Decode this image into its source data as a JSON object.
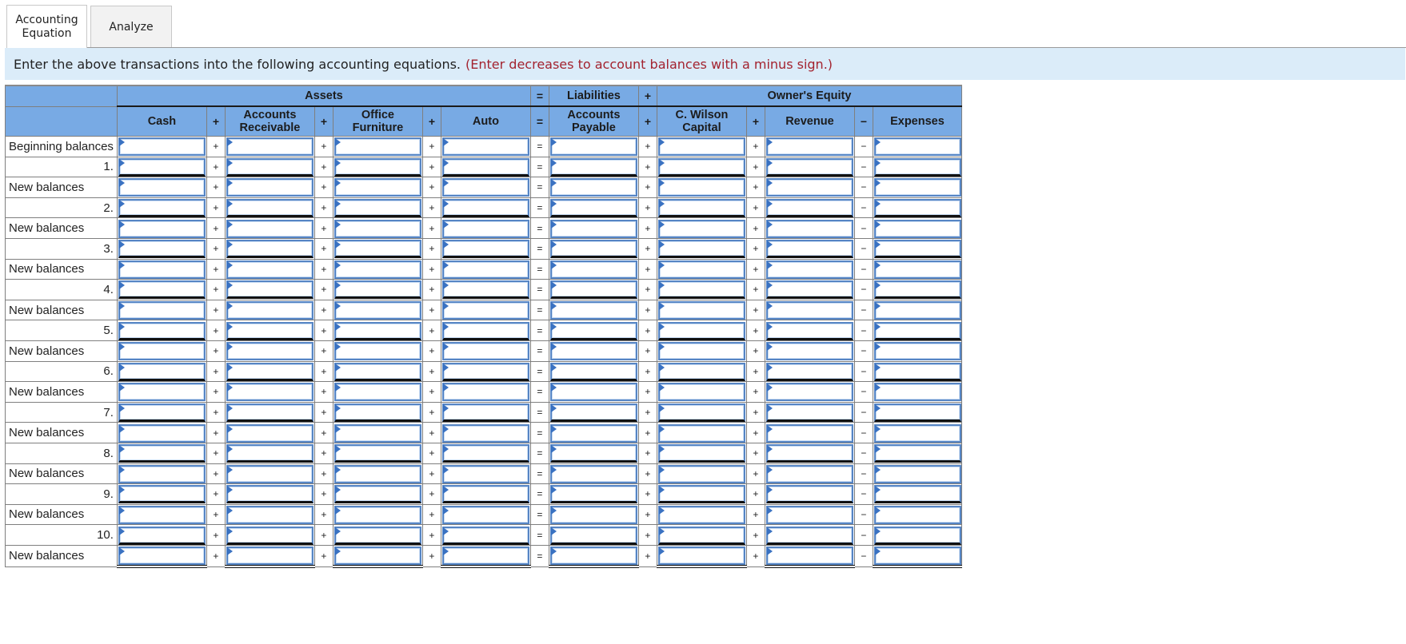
{
  "tabs": [
    {
      "label": "Accounting Equation",
      "active": true
    },
    {
      "label": "Analyze",
      "active": false
    }
  ],
  "instructions": {
    "text": "Enter the above transactions into the following accounting equations.",
    "note": "(Enter decreases to account balances with a minus sign.)"
  },
  "table": {
    "group_headers": {
      "assets": "Assets",
      "eq_sign": "=",
      "liabilities": "Liabilities",
      "plus_sign": "+",
      "owners_equity": "Owner's Equity"
    },
    "columns": [
      {
        "key": "cash",
        "label": "Cash"
      },
      {
        "key": "op1",
        "label": "+"
      },
      {
        "key": "accounts_receivable",
        "label": "Accounts Receivable"
      },
      {
        "key": "op2",
        "label": "+"
      },
      {
        "key": "office_furniture",
        "label": "Office Furniture"
      },
      {
        "key": "op3",
        "label": "+"
      },
      {
        "key": "auto",
        "label": "Auto"
      },
      {
        "key": "op4",
        "label": "="
      },
      {
        "key": "accounts_payable",
        "label": "Accounts Payable"
      },
      {
        "key": "op5",
        "label": "+"
      },
      {
        "key": "c_wilson_capital",
        "label": "C. Wilson Capital"
      },
      {
        "key": "op6",
        "label": "+"
      },
      {
        "key": "revenue",
        "label": "Revenue"
      },
      {
        "key": "op7",
        "label": "−"
      },
      {
        "key": "expenses",
        "label": "Expenses"
      }
    ],
    "row_operators": [
      "+",
      "+",
      "+",
      "=",
      "+",
      "+",
      "−"
    ],
    "rows": [
      {
        "label": "Beginning balances",
        "type": "balance",
        "values": [
          "",
          "",
          "",
          "",
          "",
          "",
          "",
          ""
        ]
      },
      {
        "label": "1.",
        "type": "txn",
        "values": [
          "",
          "",
          "",
          "",
          "",
          "",
          "",
          ""
        ]
      },
      {
        "label": "New balances",
        "type": "balance",
        "values": [
          "",
          "",
          "",
          "",
          "",
          "",
          "",
          ""
        ]
      },
      {
        "label": "2.",
        "type": "txn",
        "values": [
          "",
          "",
          "",
          "",
          "",
          "",
          "",
          ""
        ]
      },
      {
        "label": "New balances",
        "type": "balance",
        "values": [
          "",
          "",
          "",
          "",
          "",
          "",
          "",
          ""
        ]
      },
      {
        "label": "3.",
        "type": "txn",
        "values": [
          "",
          "",
          "",
          "",
          "",
          "",
          "",
          ""
        ]
      },
      {
        "label": "New balances",
        "type": "balance",
        "values": [
          "",
          "",
          "",
          "",
          "",
          "",
          "",
          ""
        ]
      },
      {
        "label": "4.",
        "type": "txn",
        "values": [
          "",
          "",
          "",
          "",
          "",
          "",
          "",
          ""
        ]
      },
      {
        "label": "New balances",
        "type": "balance",
        "values": [
          "",
          "",
          "",
          "",
          "",
          "",
          "",
          ""
        ]
      },
      {
        "label": "5.",
        "type": "txn",
        "values": [
          "",
          "",
          "",
          "",
          "",
          "",
          "",
          ""
        ]
      },
      {
        "label": "New balances",
        "type": "balance",
        "values": [
          "",
          "",
          "",
          "",
          "",
          "",
          "",
          ""
        ]
      },
      {
        "label": "6.",
        "type": "txn",
        "values": [
          "",
          "",
          "",
          "",
          "",
          "",
          "",
          ""
        ]
      },
      {
        "label": "New balances",
        "type": "balance",
        "values": [
          "",
          "",
          "",
          "",
          "",
          "",
          "",
          ""
        ]
      },
      {
        "label": "7.",
        "type": "txn",
        "values": [
          "",
          "",
          "",
          "",
          "",
          "",
          "",
          ""
        ]
      },
      {
        "label": "New balances",
        "type": "balance",
        "values": [
          "",
          "",
          "",
          "",
          "",
          "",
          "",
          ""
        ]
      },
      {
        "label": "8.",
        "type": "txn",
        "values": [
          "",
          "",
          "",
          "",
          "",
          "",
          "",
          ""
        ]
      },
      {
        "label": "New balances",
        "type": "balance",
        "values": [
          "",
          "",
          "",
          "",
          "",
          "",
          "",
          ""
        ]
      },
      {
        "label": "9.",
        "type": "txn",
        "values": [
          "",
          "",
          "",
          "",
          "",
          "",
          "",
          ""
        ]
      },
      {
        "label": "New balances",
        "type": "balance",
        "values": [
          "",
          "",
          "",
          "",
          "",
          "",
          "",
          ""
        ]
      },
      {
        "label": "10.",
        "type": "txn",
        "values": [
          "",
          "",
          "",
          "",
          "",
          "",
          "",
          ""
        ]
      },
      {
        "label": "New balances",
        "type": "balance",
        "values": [
          "",
          "",
          "",
          "",
          "",
          "",
          "",
          ""
        ]
      }
    ]
  },
  "colors": {
    "header_blue": "#78aae4",
    "banner_bg": "#dbecf9",
    "note_red": "#a3232f",
    "input_border": "#5685c4",
    "input_flag": "#3a72c2"
  }
}
